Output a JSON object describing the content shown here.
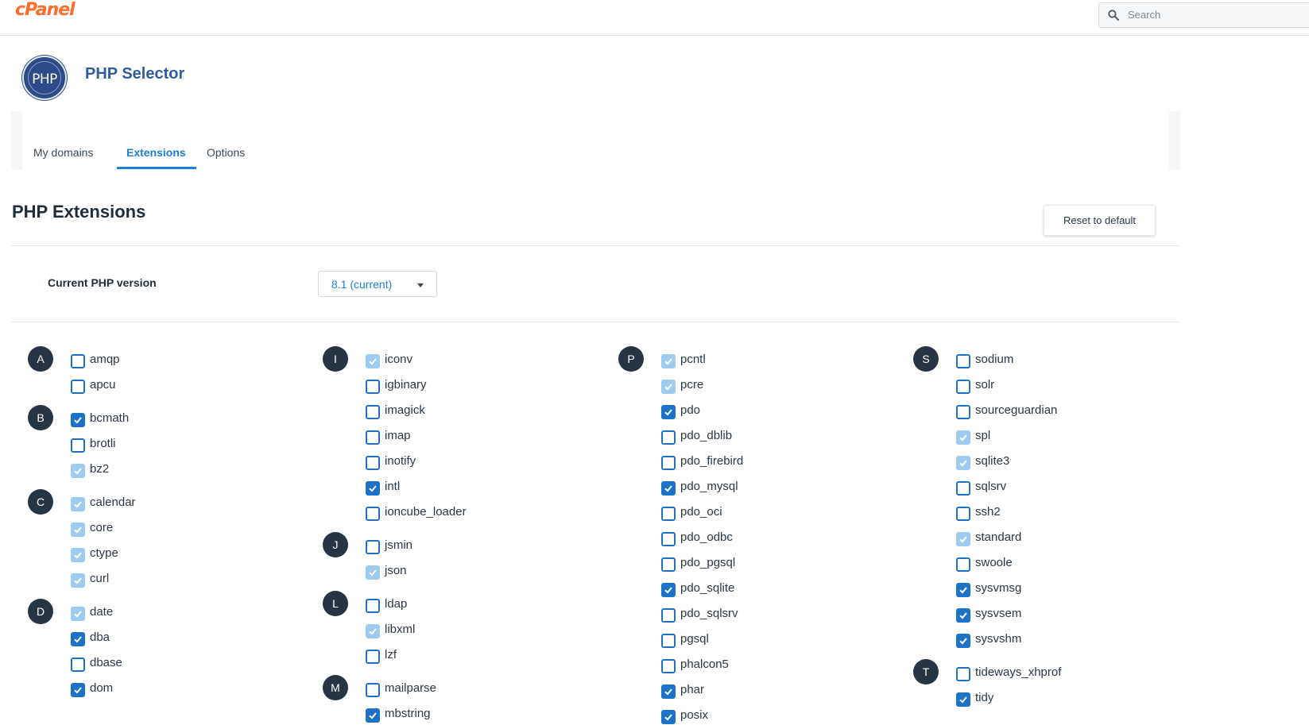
{
  "header": {
    "logo_text": "cPanel",
    "search_placeholder": "Search",
    "search_icon": "search-icon"
  },
  "app": {
    "title": "PHP Selector",
    "icon_text": "PHP"
  },
  "tabs": [
    {
      "label": "My domains",
      "active": false
    },
    {
      "label": "Extensions",
      "active": true
    },
    {
      "label": "Options",
      "active": false
    }
  ],
  "section": {
    "title": "PHP Extensions",
    "reset_label": "Reset to default"
  },
  "version": {
    "label": "Current PHP version",
    "selected": "8.1 (current)"
  },
  "colors": {
    "accent": "#1d7fd6",
    "brand": "#ff6c2c",
    "letter_badge": "#263444",
    "disabled_check": "#9ecbf0"
  },
  "columns": [
    [
      {
        "letter": "A",
        "items": [
          {
            "name": "amqp",
            "state": "off"
          },
          {
            "name": "apcu",
            "state": "off"
          }
        ]
      },
      {
        "letter": "B",
        "items": [
          {
            "name": "bcmath",
            "state": "on"
          },
          {
            "name": "brotli",
            "state": "off"
          },
          {
            "name": "bz2",
            "state": "disabled"
          }
        ]
      },
      {
        "letter": "C",
        "items": [
          {
            "name": "calendar",
            "state": "disabled"
          },
          {
            "name": "core",
            "state": "disabled"
          },
          {
            "name": "ctype",
            "state": "disabled"
          },
          {
            "name": "curl",
            "state": "disabled"
          }
        ]
      },
      {
        "letter": "D",
        "items": [
          {
            "name": "date",
            "state": "disabled"
          },
          {
            "name": "dba",
            "state": "on"
          },
          {
            "name": "dbase",
            "state": "off"
          },
          {
            "name": "dom",
            "state": "on"
          }
        ]
      }
    ],
    [
      {
        "letter": "I",
        "items": [
          {
            "name": "iconv",
            "state": "disabled"
          },
          {
            "name": "igbinary",
            "state": "off"
          },
          {
            "name": "imagick",
            "state": "off"
          },
          {
            "name": "imap",
            "state": "off"
          },
          {
            "name": "inotify",
            "state": "off"
          },
          {
            "name": "intl",
            "state": "on"
          },
          {
            "name": "ioncube_loader",
            "state": "off"
          }
        ]
      },
      {
        "letter": "J",
        "items": [
          {
            "name": "jsmin",
            "state": "off"
          },
          {
            "name": "json",
            "state": "disabled"
          }
        ]
      },
      {
        "letter": "L",
        "items": [
          {
            "name": "ldap",
            "state": "off"
          },
          {
            "name": "libxml",
            "state": "disabled"
          },
          {
            "name": "lzf",
            "state": "off"
          }
        ]
      },
      {
        "letter": "M",
        "items": [
          {
            "name": "mailparse",
            "state": "off"
          },
          {
            "name": "mbstring",
            "state": "on"
          }
        ]
      }
    ],
    [
      {
        "letter": "P",
        "items": [
          {
            "name": "pcntl",
            "state": "disabled"
          },
          {
            "name": "pcre",
            "state": "disabled"
          },
          {
            "name": "pdo",
            "state": "on"
          },
          {
            "name": "pdo_dblib",
            "state": "off"
          },
          {
            "name": "pdo_firebird",
            "state": "off"
          },
          {
            "name": "pdo_mysql",
            "state": "on"
          },
          {
            "name": "pdo_oci",
            "state": "off"
          },
          {
            "name": "pdo_odbc",
            "state": "off"
          },
          {
            "name": "pdo_pgsql",
            "state": "off"
          },
          {
            "name": "pdo_sqlite",
            "state": "on"
          },
          {
            "name": "pdo_sqlsrv",
            "state": "off"
          },
          {
            "name": "pgsql",
            "state": "off"
          },
          {
            "name": "phalcon5",
            "state": "off"
          },
          {
            "name": "phar",
            "state": "on"
          },
          {
            "name": "posix",
            "state": "on"
          }
        ]
      }
    ],
    [
      {
        "letter": "S",
        "items": [
          {
            "name": "sodium",
            "state": "off"
          },
          {
            "name": "solr",
            "state": "off"
          },
          {
            "name": "sourceguardian",
            "state": "off"
          },
          {
            "name": "spl",
            "state": "disabled"
          },
          {
            "name": "sqlite3",
            "state": "disabled"
          },
          {
            "name": "sqlsrv",
            "state": "off"
          },
          {
            "name": "ssh2",
            "state": "off"
          },
          {
            "name": "standard",
            "state": "disabled"
          },
          {
            "name": "swoole",
            "state": "off"
          },
          {
            "name": "sysvmsg",
            "state": "on"
          },
          {
            "name": "sysvsem",
            "state": "on"
          },
          {
            "name": "sysvshm",
            "state": "on"
          }
        ]
      },
      {
        "letter": "T",
        "items": [
          {
            "name": "tideways_xhprof",
            "state": "off"
          },
          {
            "name": "tidy",
            "state": "on"
          }
        ]
      }
    ]
  ]
}
